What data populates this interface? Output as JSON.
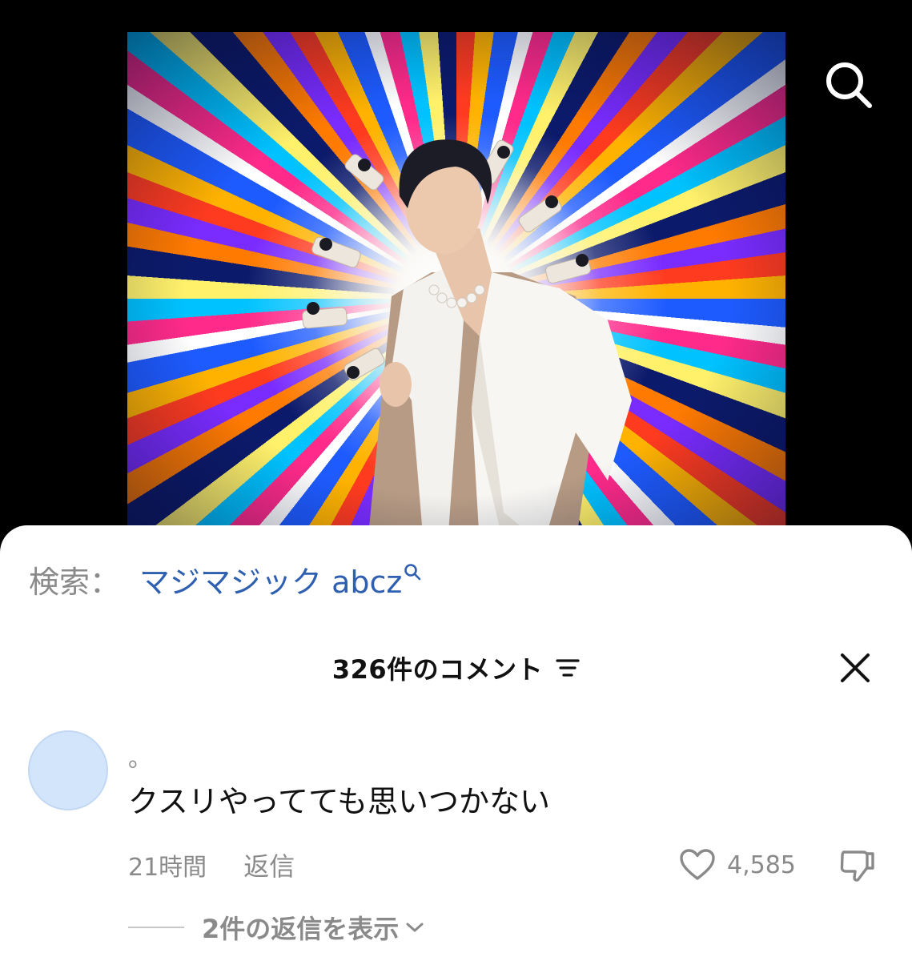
{
  "search": {
    "prefix": "検索：",
    "query": "マジマジック abcz"
  },
  "comments_header": {
    "count_label": "326件のコメント"
  },
  "comment": {
    "username": "。",
    "text": "クスリやってても思いつかない",
    "timestamp": "21時間",
    "reply_label": "返信",
    "like_count": "4,585",
    "view_replies_label": "2件の返信を表示"
  },
  "colors": {
    "link": "#2e5fb0",
    "muted": "#8a8a8a",
    "avatar_bg": "#d3e5fb",
    "sheet_bg": "#ffffff",
    "screen_bg": "#000000"
  },
  "icons": {
    "search": "search-icon",
    "sort": "sort-icon",
    "close": "close-icon",
    "like": "heart-outline-icon",
    "dislike": "thumbs-down-icon",
    "expand": "chevron-down-icon"
  }
}
